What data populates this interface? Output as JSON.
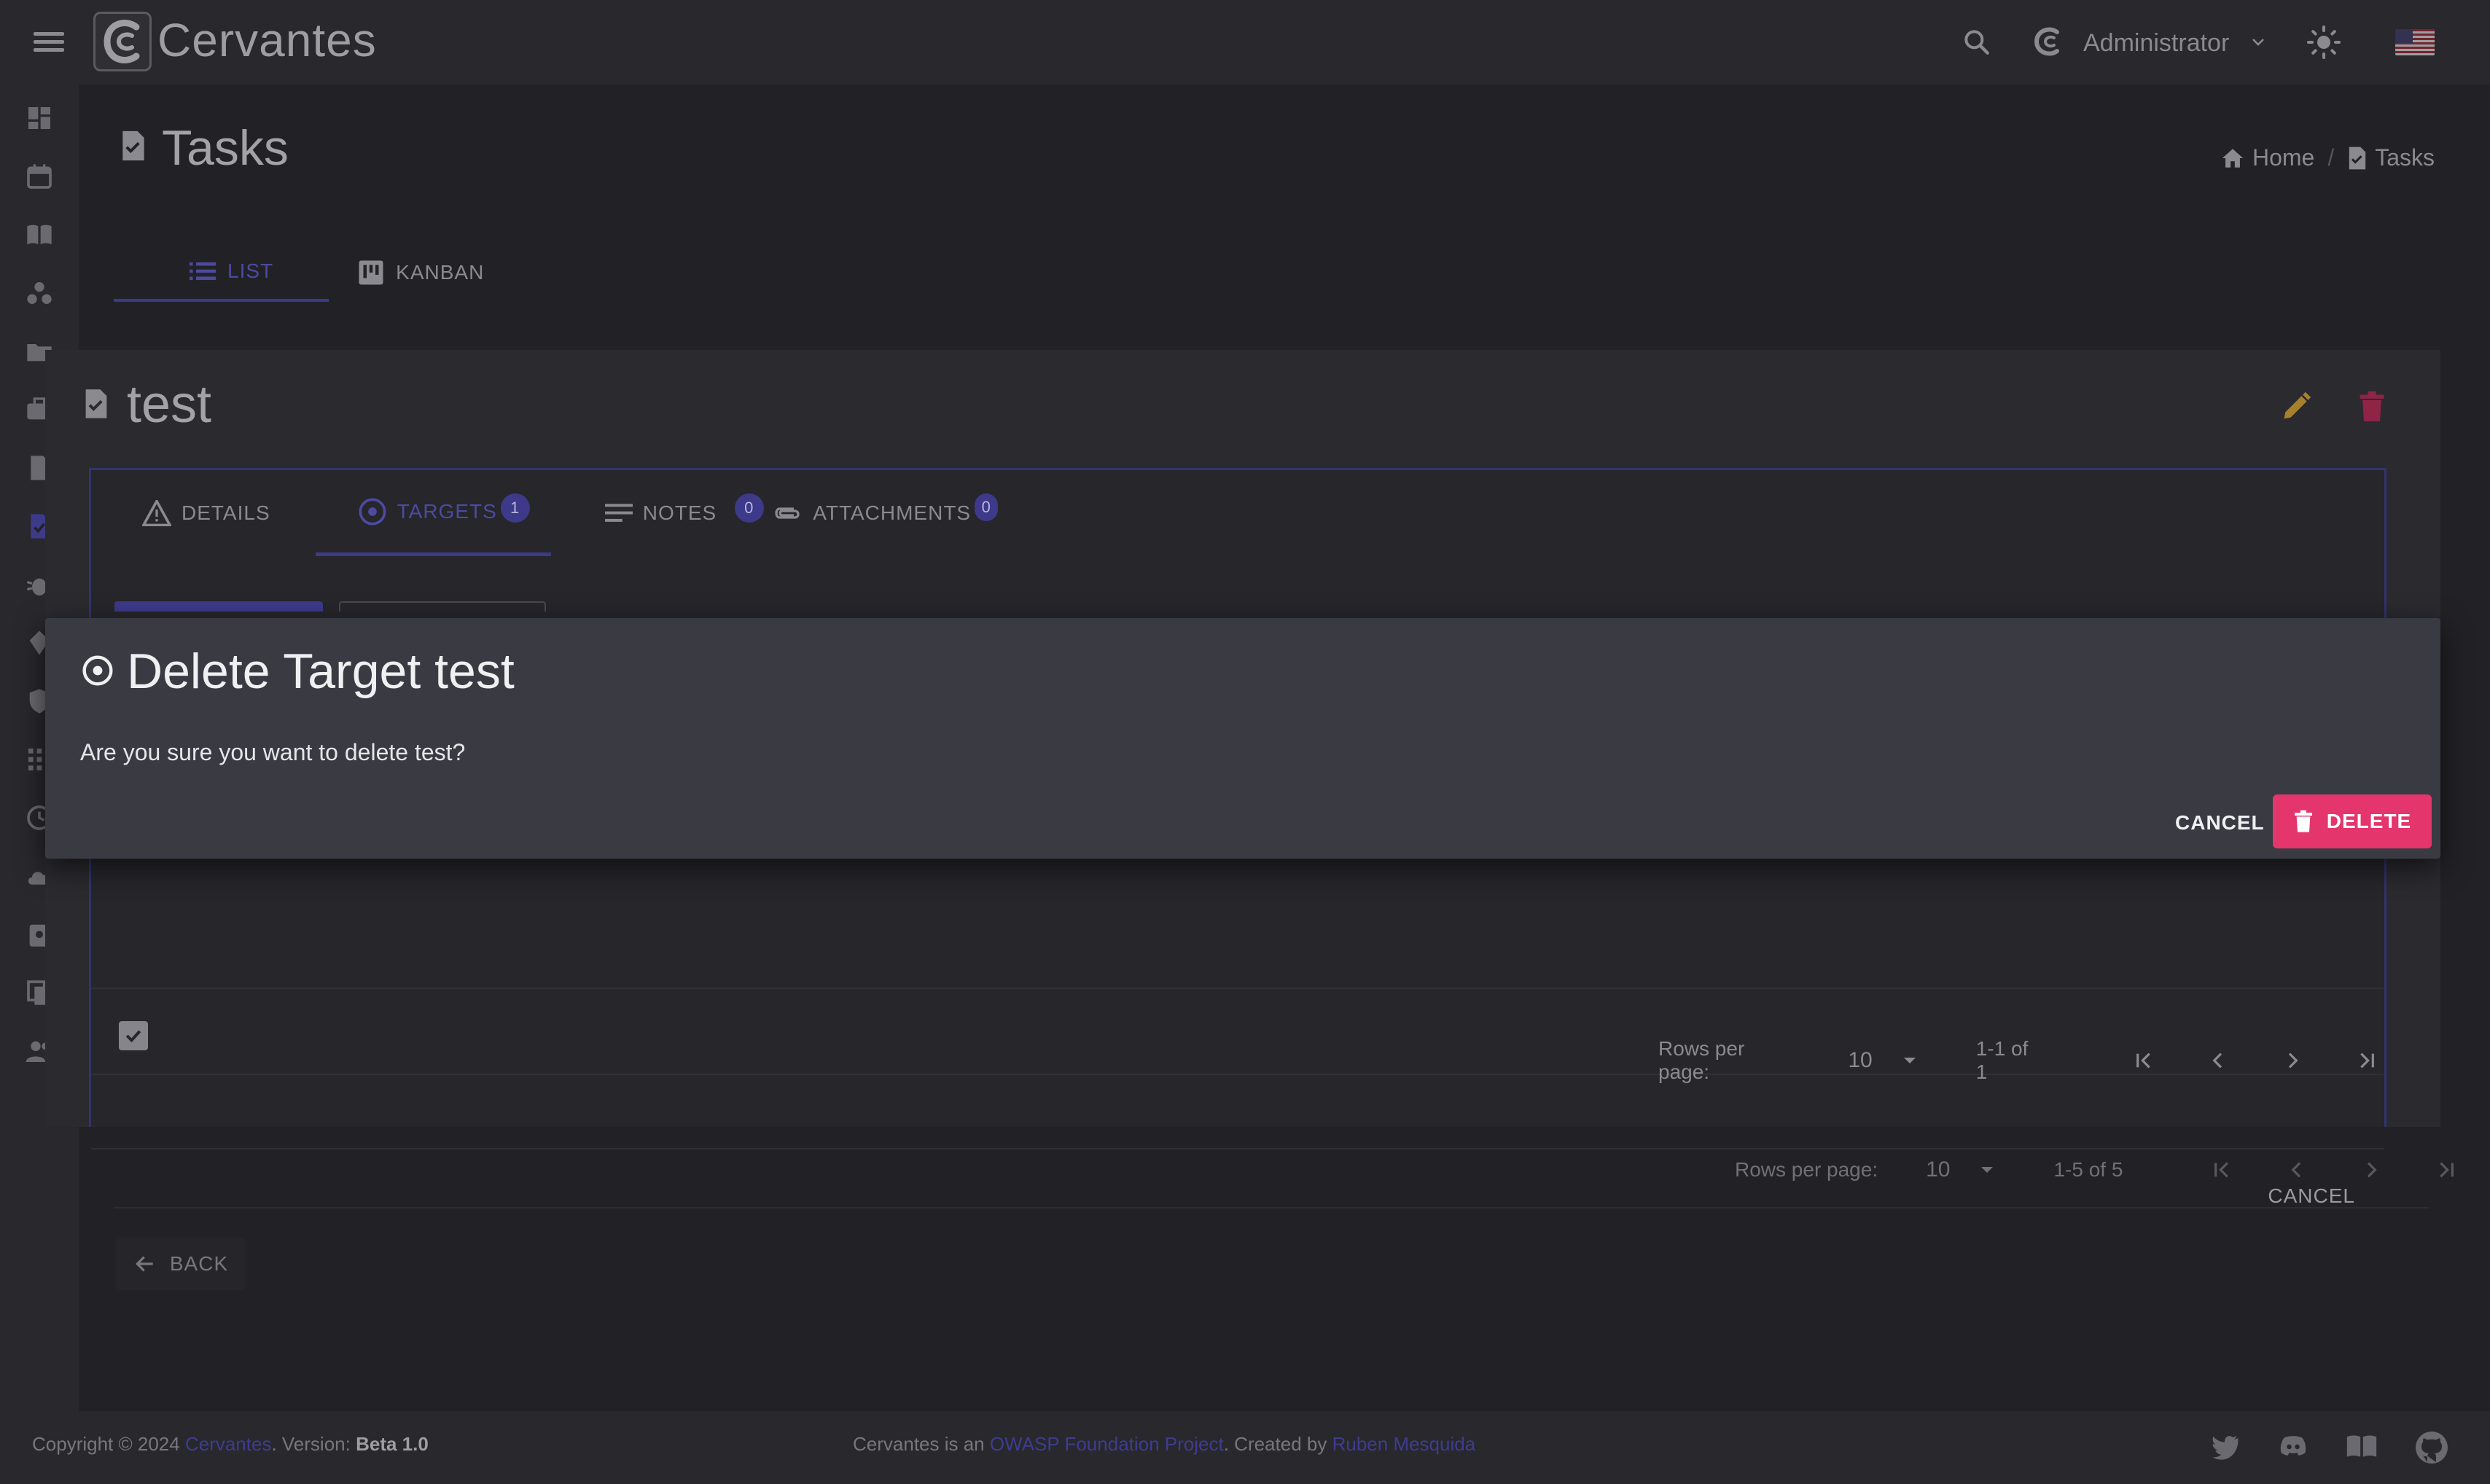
{
  "app": {
    "name": "Cervantes"
  },
  "header": {
    "user_name": "Administrator"
  },
  "page": {
    "title": "Tasks",
    "breadcrumb": [
      {
        "label": "Home"
      },
      {
        "label": "Tasks"
      }
    ],
    "view_tabs": [
      {
        "label": "LIST"
      },
      {
        "label": "KANBAN"
      }
    ]
  },
  "task": {
    "title": "test",
    "tabs": [
      {
        "label": "DETAILS"
      },
      {
        "label": "TARGETS",
        "badge": "1"
      },
      {
        "label": "NOTES",
        "badge": "0"
      },
      {
        "label": "ATTACHMENTS",
        "badge": "0"
      }
    ],
    "pager": {
      "rows_label": "Rows per page:",
      "rows_value": "10",
      "range": "1-1 of 1"
    },
    "cancel_label": "CANCEL"
  },
  "outer_pager": {
    "rows_label": "Rows per page:",
    "rows_value": "10",
    "range": "1-5 of 5"
  },
  "back_label": "BACK",
  "dialog": {
    "title": "Delete Target test",
    "message": "Are you sure you want to delete test?",
    "cancel_label": "CANCEL",
    "delete_label": "DELETE"
  },
  "footer": {
    "copyright": "Copyright © 2024",
    "brand_link": "Cervantes",
    "version_prefix": ". Version:",
    "version": "Beta 1.0",
    "center_prefix": "Cervantes is an",
    "owasp_link": "OWASP Foundation Project",
    "created_by": ". Created by",
    "author_link": "Ruben Mesquida"
  },
  "colors": {
    "accent": "#3d3a8a",
    "danger": "#e4356d",
    "edit": "#a8802c",
    "dialog_bg": "#3a3a42"
  }
}
